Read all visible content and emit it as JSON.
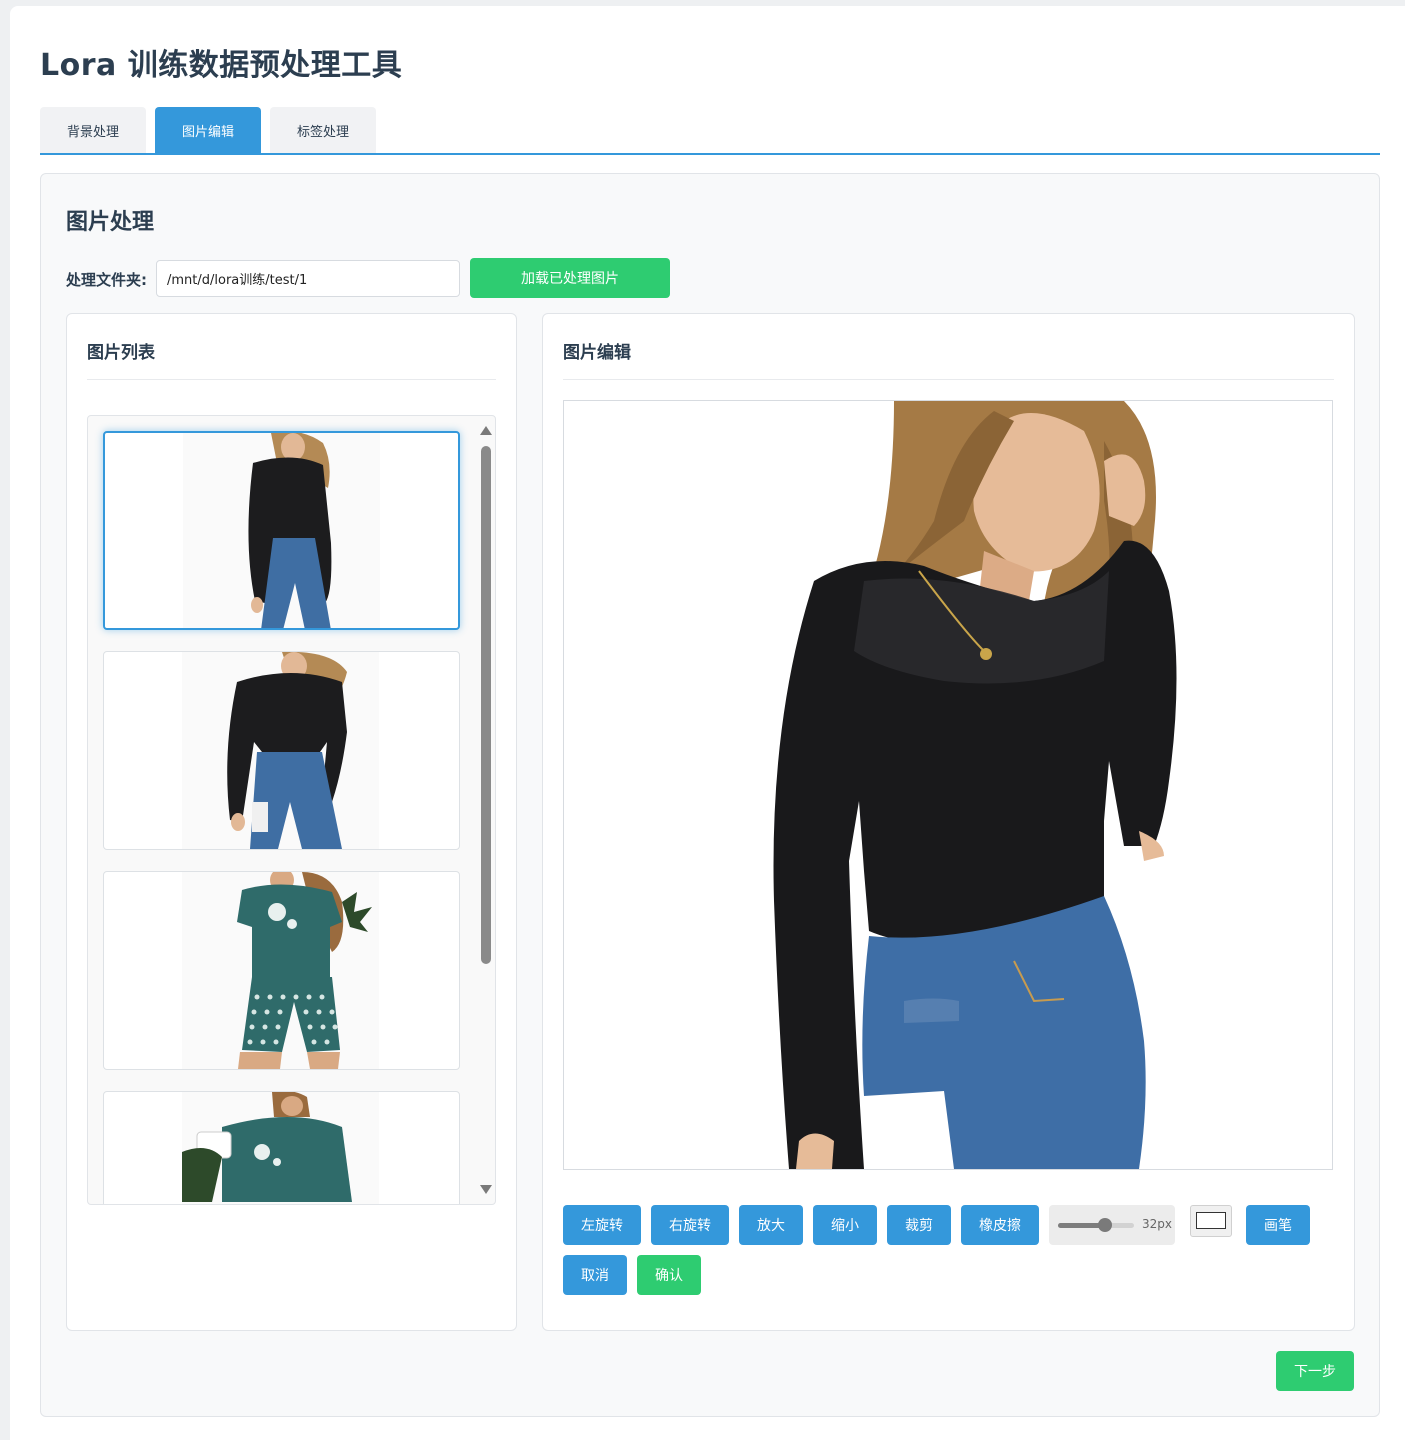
{
  "app": {
    "title": "Lora 训练数据预处理工具"
  },
  "tabs": [
    {
      "label": "背景处理",
      "active": false
    },
    {
      "label": "图片编辑",
      "active": true
    },
    {
      "label": "标签处理",
      "active": false
    }
  ],
  "panel": {
    "title": "图片处理",
    "folder_label": "处理文件夹:",
    "folder_value": "/mnt/d/lora训练/test/1",
    "load_button": "加载已处理图片"
  },
  "image_list": {
    "title": "图片列表",
    "thumbnails": [
      {
        "name": "woman in black mesh top and jeans",
        "selected": true
      },
      {
        "name": "woman in black mesh top and jeans, alternate pose",
        "selected": false
      },
      {
        "name": "woman in teal dandelion t-shirt and polka dot shorts",
        "selected": false
      },
      {
        "name": "woman in teal dandelion t-shirt holding mug",
        "selected": false
      }
    ]
  },
  "editor": {
    "title": "图片编辑",
    "tools": {
      "rotate_left": "左旋转",
      "rotate_right": "右旋转",
      "zoom_in": "放大",
      "zoom_out": "缩小",
      "crop": "裁剪",
      "eraser": "橡皮擦",
      "brush_size": "32px",
      "brush_size_value": 32,
      "brush_size_fraction": 0.62,
      "brush_color": "#ffffff",
      "brush": "画笔",
      "cancel": "取消",
      "confirm": "确认"
    }
  },
  "footer": {
    "next_button": "下一步"
  },
  "colors": {
    "accent": "#3498db",
    "success": "#2ecc71",
    "text": "#2c3e50"
  }
}
